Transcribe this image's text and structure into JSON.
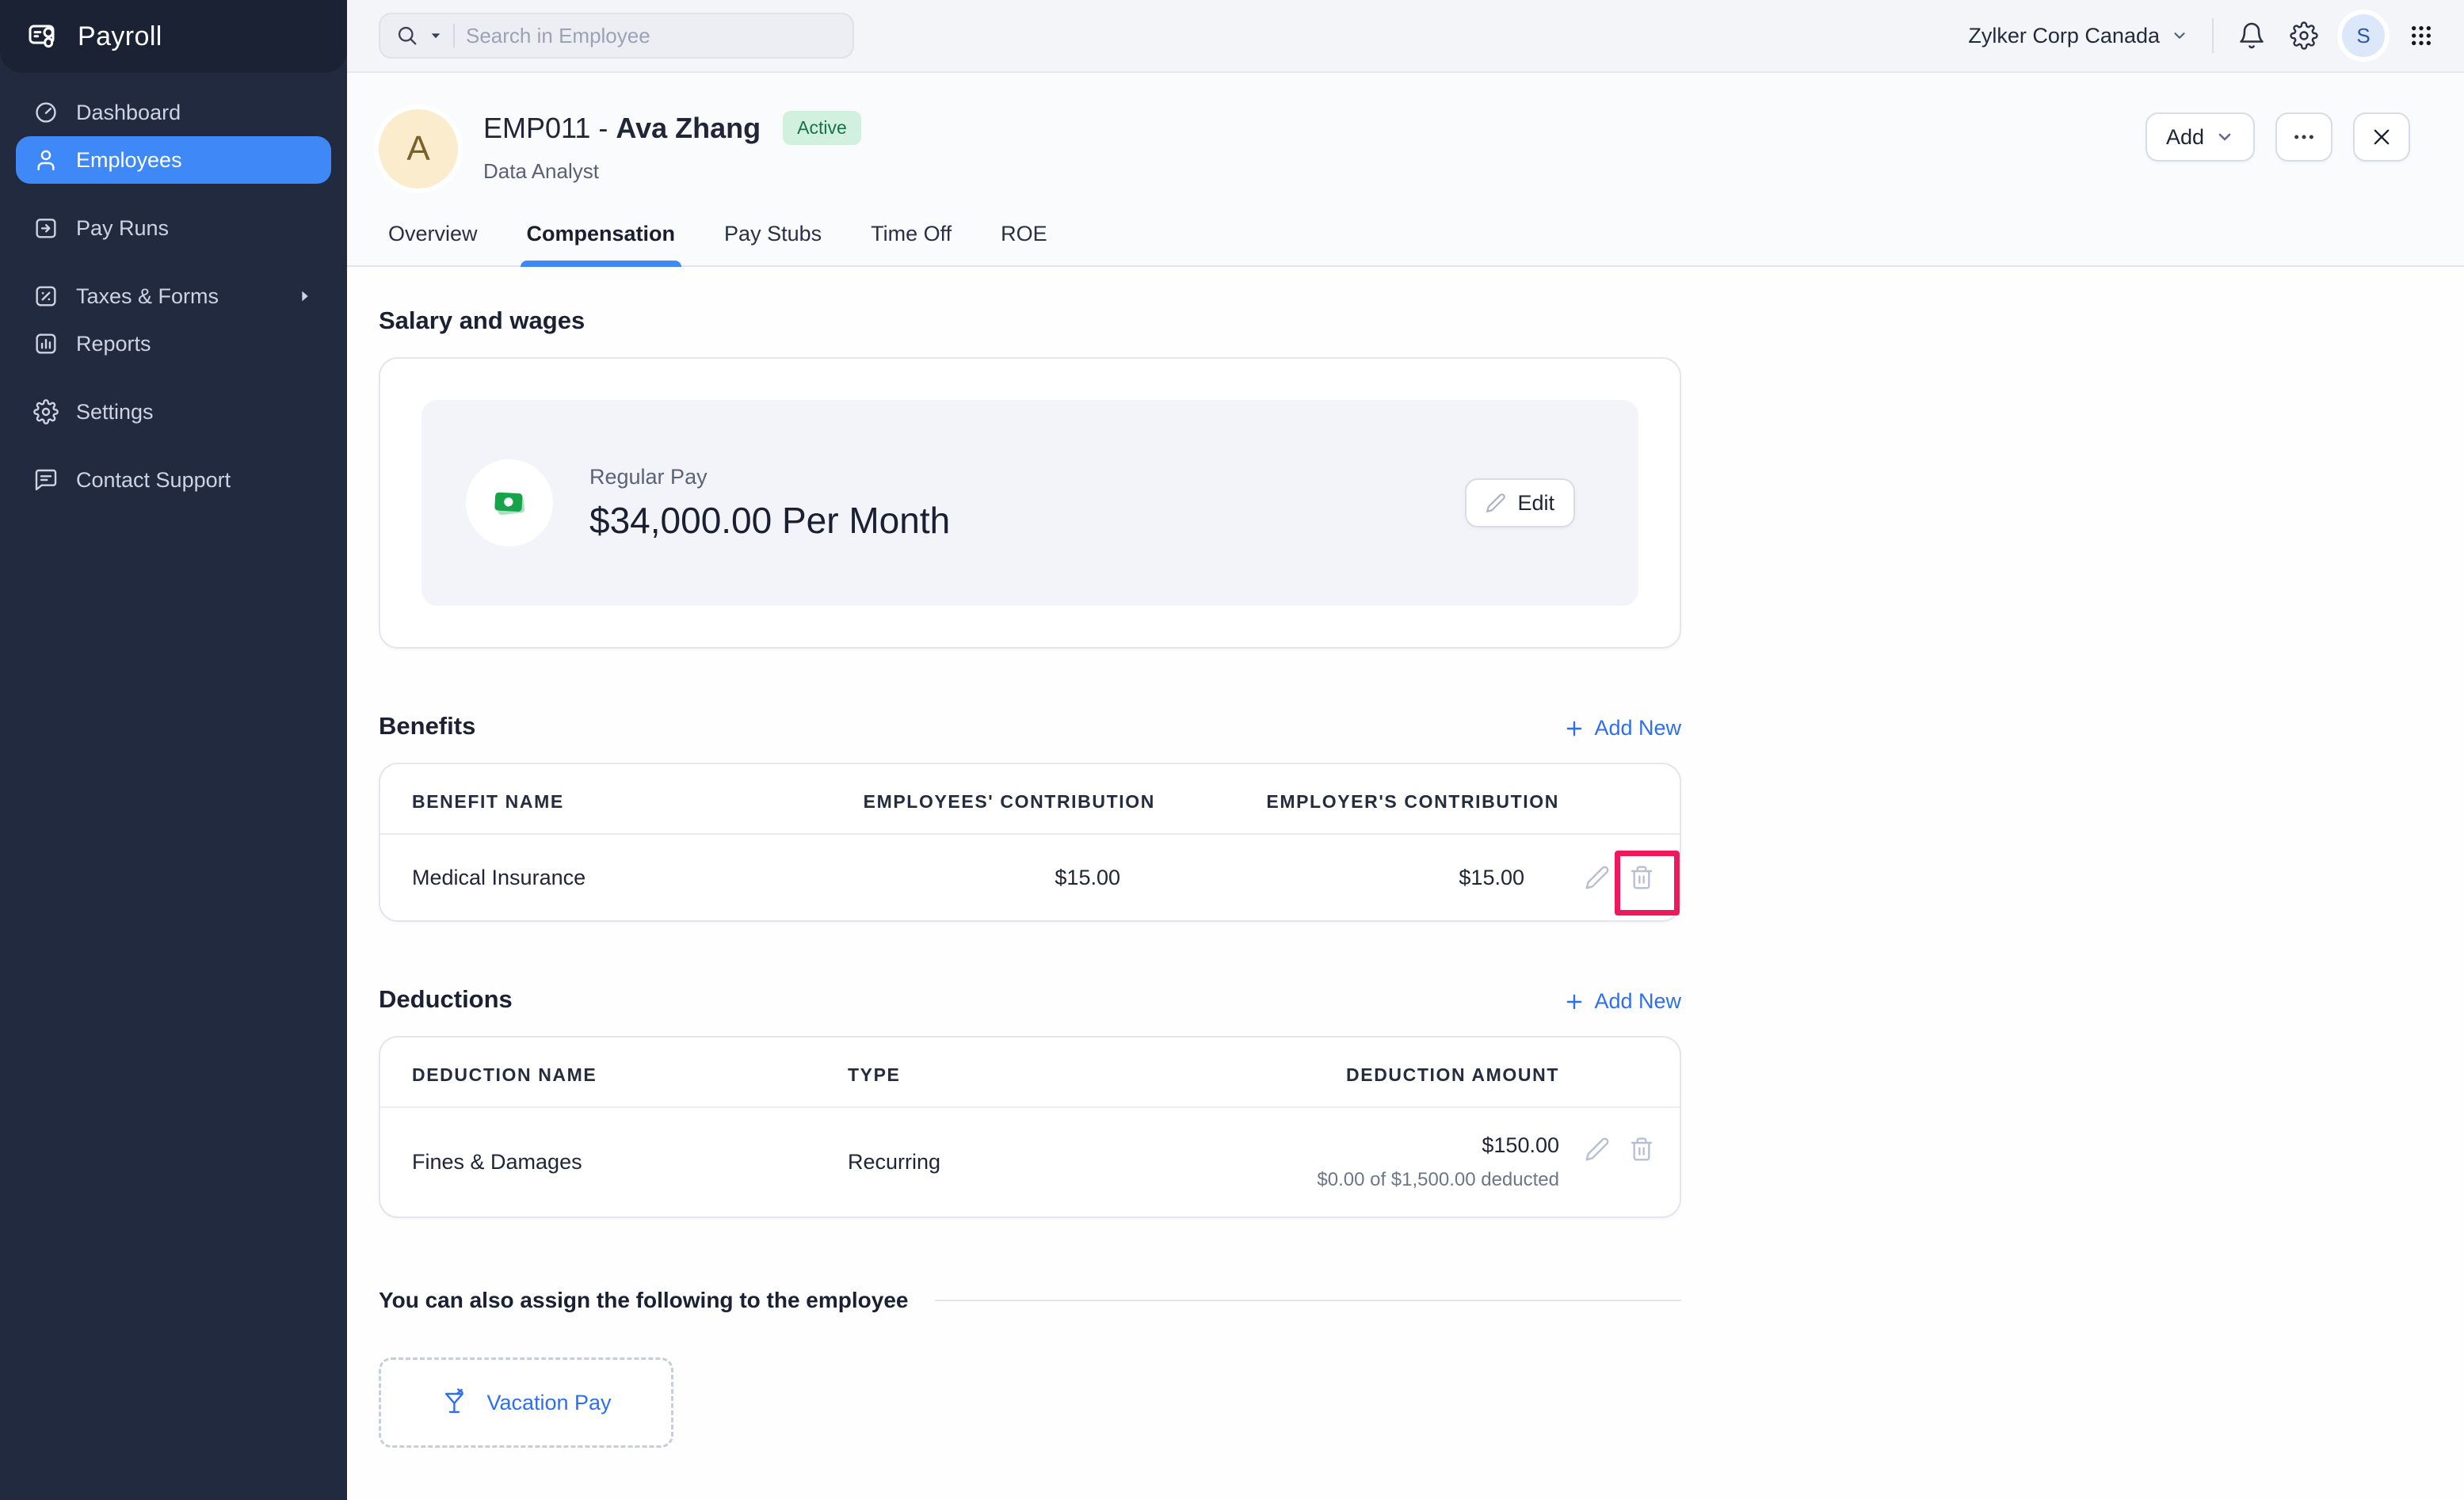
{
  "app": {
    "title": "Payroll"
  },
  "sidebar": {
    "items": [
      {
        "label": "Dashboard",
        "active": false
      },
      {
        "label": "Employees",
        "active": true
      },
      {
        "label": "Pay Runs",
        "active": false
      },
      {
        "label": "Taxes & Forms",
        "active": false,
        "has_submenu": true
      },
      {
        "label": "Reports",
        "active": false
      },
      {
        "label": "Settings",
        "active": false
      },
      {
        "label": "Contact Support",
        "active": false
      }
    ]
  },
  "topbar": {
    "search_placeholder": "Search in Employee",
    "company": "Zylker Corp Canada"
  },
  "header": {
    "avatar_letter": "A",
    "employee_code": "EMP011",
    "separator": "-",
    "employee_name": "Ava Zhang",
    "status": "Active",
    "role": "Data Analyst",
    "add_label": "Add"
  },
  "tabs": {
    "items": [
      "Overview",
      "Compensation",
      "Pay Stubs",
      "Time Off",
      "ROE"
    ],
    "active": "Compensation"
  },
  "salary": {
    "section_title": "Salary and wages",
    "pay_type": "Regular Pay",
    "amount": "$34,000.00 Per Month",
    "edit_label": "Edit"
  },
  "benefits": {
    "title": "Benefits",
    "add_new_label": "Add New",
    "columns": [
      "BENEFIT NAME",
      "EMPLOYEES' CONTRIBUTION",
      "EMPLOYER'S CONTRIBUTION"
    ],
    "rows": [
      {
        "name": "Medical Insurance",
        "employees_contribution": "$15.00",
        "employers_contribution": "$15.00"
      }
    ]
  },
  "deductions": {
    "title": "Deductions",
    "add_new_label": "Add New",
    "columns": [
      "DEDUCTION NAME",
      "TYPE",
      "DEDUCTION AMOUNT"
    ],
    "rows": [
      {
        "name": "Fines & Damages",
        "type": "Recurring",
        "amount": "$150.00",
        "note": "$0.00 of $1,500.00 deducted"
      }
    ]
  },
  "assign": {
    "title": "You can also assign the following to the employee",
    "options": [
      {
        "label": "Vacation Pay"
      }
    ]
  },
  "colors": {
    "sidebar_bg": "#222A40",
    "accent_blue": "#3F88F8",
    "link_blue": "#2D6FF2",
    "status_active_bg": "#D2F0DE",
    "status_active_text": "#17714A",
    "avatar_bg": "#FAECCC",
    "money_green": "#16A34A",
    "annotation_red": "#F0185C"
  }
}
